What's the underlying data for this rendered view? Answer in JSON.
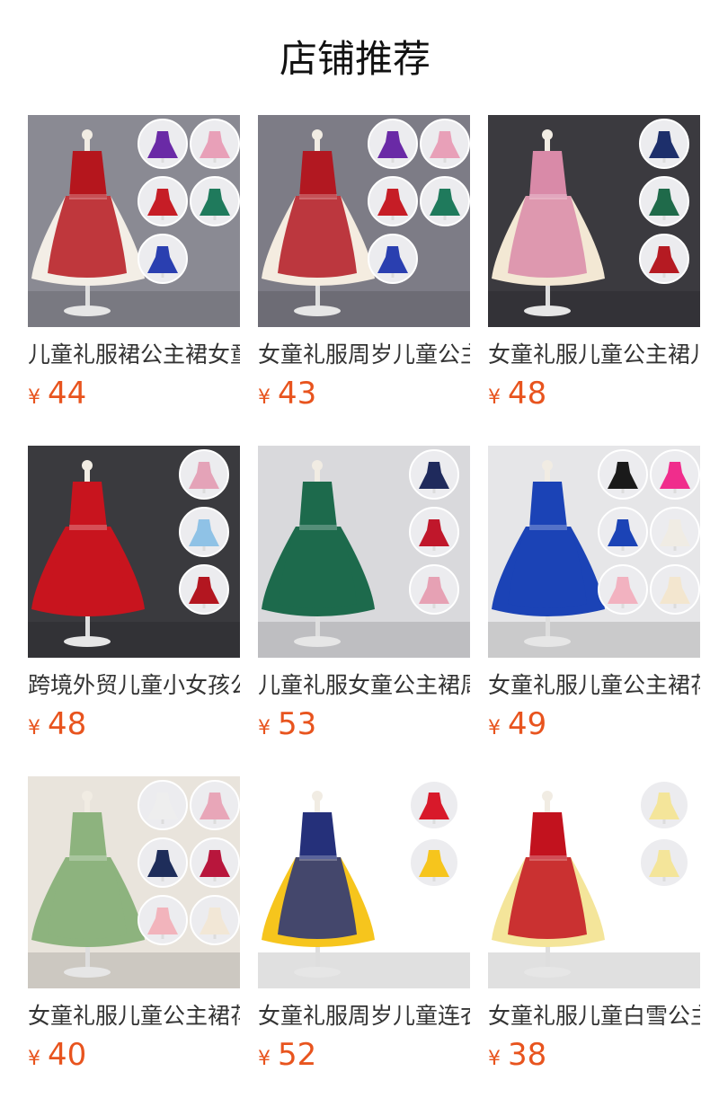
{
  "header": {
    "title": "店铺推荐"
  },
  "currency_symbol": "¥",
  "products": [
    {
      "name": "儿童礼服裙公主裙女童",
      "price": "44",
      "dress_color": "#b5161d",
      "skirt_color": "#f3eee6",
      "bg": "#8a8a93",
      "variant_colors": [
        "#6a2aa6",
        "#e8a0b8",
        "#c61d26",
        "#1f7a5c",
        "#2a3fb0"
      ]
    },
    {
      "name": "女童礼服周岁儿童公主",
      "price": "43",
      "dress_color": "#b21821",
      "skirt_color": "#f4ece0",
      "bg": "#7d7c86",
      "variant_colors": [
        "#6a2aa6",
        "#e8a0b8",
        "#c61d26",
        "#1f7a5c",
        "#2a3fb0"
      ]
    },
    {
      "name": "女童礼服儿童公主裙儿",
      "price": "48",
      "dress_color": "#d98aa8",
      "skirt_color": "#f3e8d4",
      "bg": "#3b3a3f",
      "variant_colors": [
        "#1d2f6b",
        "#1f6a4a",
        "#b51a22"
      ]
    },
    {
      "name": "跨境外贸儿童小女孩公",
      "price": "48",
      "dress_color": "#c8141e",
      "skirt_color": "#c8141e",
      "bg": "#3a3a3e",
      "variant_colors": [
        "#e4a3b8",
        "#8fc2e6",
        "#b31620"
      ]
    },
    {
      "name": "儿童礼服女童公主裙周",
      "price": "53",
      "dress_color": "#1d6a4c",
      "skirt_color": "#1d6a4c",
      "bg": "#d9d9dc",
      "variant_colors": [
        "#1f2a5c",
        "#c0172b",
        "#e6a1b4"
      ]
    },
    {
      "name": "女童礼服儿童公主裙花",
      "price": "49",
      "dress_color": "#1b43b6",
      "skirt_color": "#1b43b6",
      "bg": "#e6e6e8",
      "variant_colors": [
        "#1a1a1a",
        "#f02d8c",
        "#1b43b6",
        "#f0ece4",
        "#f2b2c0",
        "#f3e6cf"
      ]
    },
    {
      "name": "女童礼服儿童公主裙花",
      "price": "40",
      "dress_color": "#8db37e",
      "skirt_color": "#8db37e",
      "bg": "#e9e4dc",
      "variant_colors": [
        "#eeeeee",
        "#e8a6b8",
        "#1e2d5a",
        "#b8163c",
        "#f2b4bc",
        "#f2e7d6"
      ]
    },
    {
      "name": "女童礼服周岁儿童连衣",
      "price": "52",
      "dress_color": "#25307a",
      "skirt_color": "#f6c51d",
      "bg": "#ffffff",
      "variant_colors": [
        "#d8192a",
        "#f6c51d"
      ]
    },
    {
      "name": "女童礼服儿童白雪公主",
      "price": "38",
      "dress_color": "#c2121e",
      "skirt_color": "#f4e59a",
      "bg": "#ffffff",
      "variant_colors": [
        "#f4e59a",
        "#f4e59a"
      ]
    }
  ]
}
